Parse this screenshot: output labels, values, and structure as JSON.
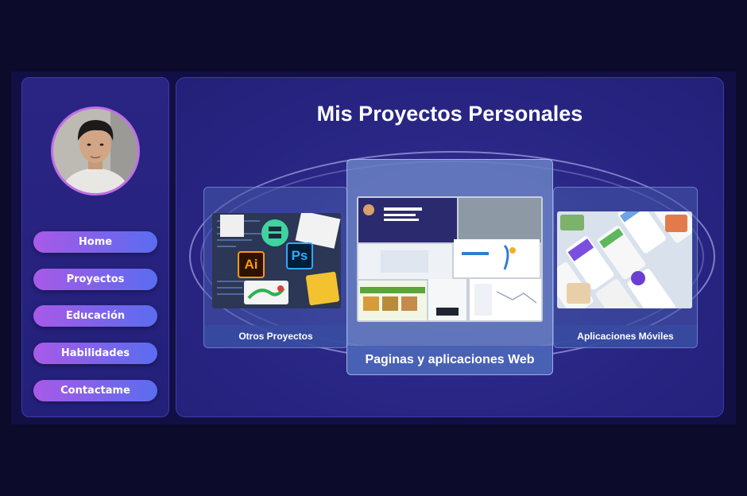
{
  "sidebar": {
    "nav": [
      {
        "label": "Home"
      },
      {
        "label": "Proyectos"
      },
      {
        "label": "Educación"
      },
      {
        "label": "Habilidades"
      },
      {
        "label": "Contactame"
      }
    ]
  },
  "main": {
    "title": "Mis Proyectos Personales",
    "cards": [
      {
        "label": "Otros Proyectos",
        "icons": [
          "ai-icon",
          "ps-icon",
          "server-icon"
        ],
        "thumb_text": [
          "Ai",
          "Ps"
        ]
      },
      {
        "label": "Paginas y aplicaciones Web"
      },
      {
        "label": "Aplicaciones Móviles"
      }
    ]
  },
  "colors": {
    "background": "#0d0b2b",
    "panel": "#2a2786",
    "nav_gradient_start": "#a85ae8",
    "nav_gradient_end": "#5a6df0",
    "avatar_border": "#c06ee6"
  }
}
